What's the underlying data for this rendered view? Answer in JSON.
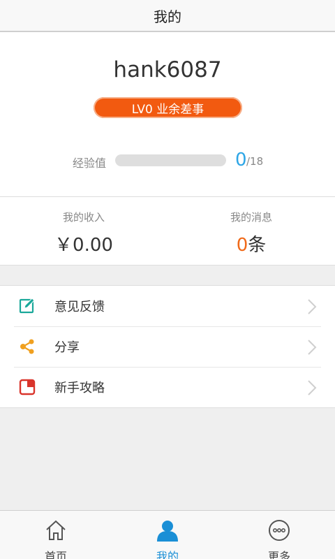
{
  "header": {
    "title": "我的"
  },
  "profile": {
    "username": "hank6087",
    "level_badge": "LV0 业余差事",
    "exp_label": "经验值",
    "exp_current": "0",
    "exp_total": "/18",
    "exp_progress": 0
  },
  "stats": {
    "income_label": "我的收入",
    "income_value": "￥0.00",
    "messages_label": "我的消息",
    "messages_count": "0",
    "messages_unit": "条"
  },
  "menu": {
    "items": [
      {
        "label": "意见反馈",
        "icon": "edit-icon",
        "color": "#1aa89a"
      },
      {
        "label": "分享",
        "icon": "share-icon",
        "color": "#f0a020"
      },
      {
        "label": "新手攻略",
        "icon": "guide-icon",
        "color": "#d9342b"
      }
    ]
  },
  "tabbar": {
    "tabs": [
      {
        "label": "首页",
        "icon": "home-icon"
      },
      {
        "label": "我的",
        "icon": "user-icon",
        "active": true
      },
      {
        "label": "更多",
        "icon": "more-icon"
      }
    ]
  },
  "colors": {
    "accent": "#2ea6e6",
    "badge": "#f25a10",
    "tab_active": "#1a8fd6"
  }
}
